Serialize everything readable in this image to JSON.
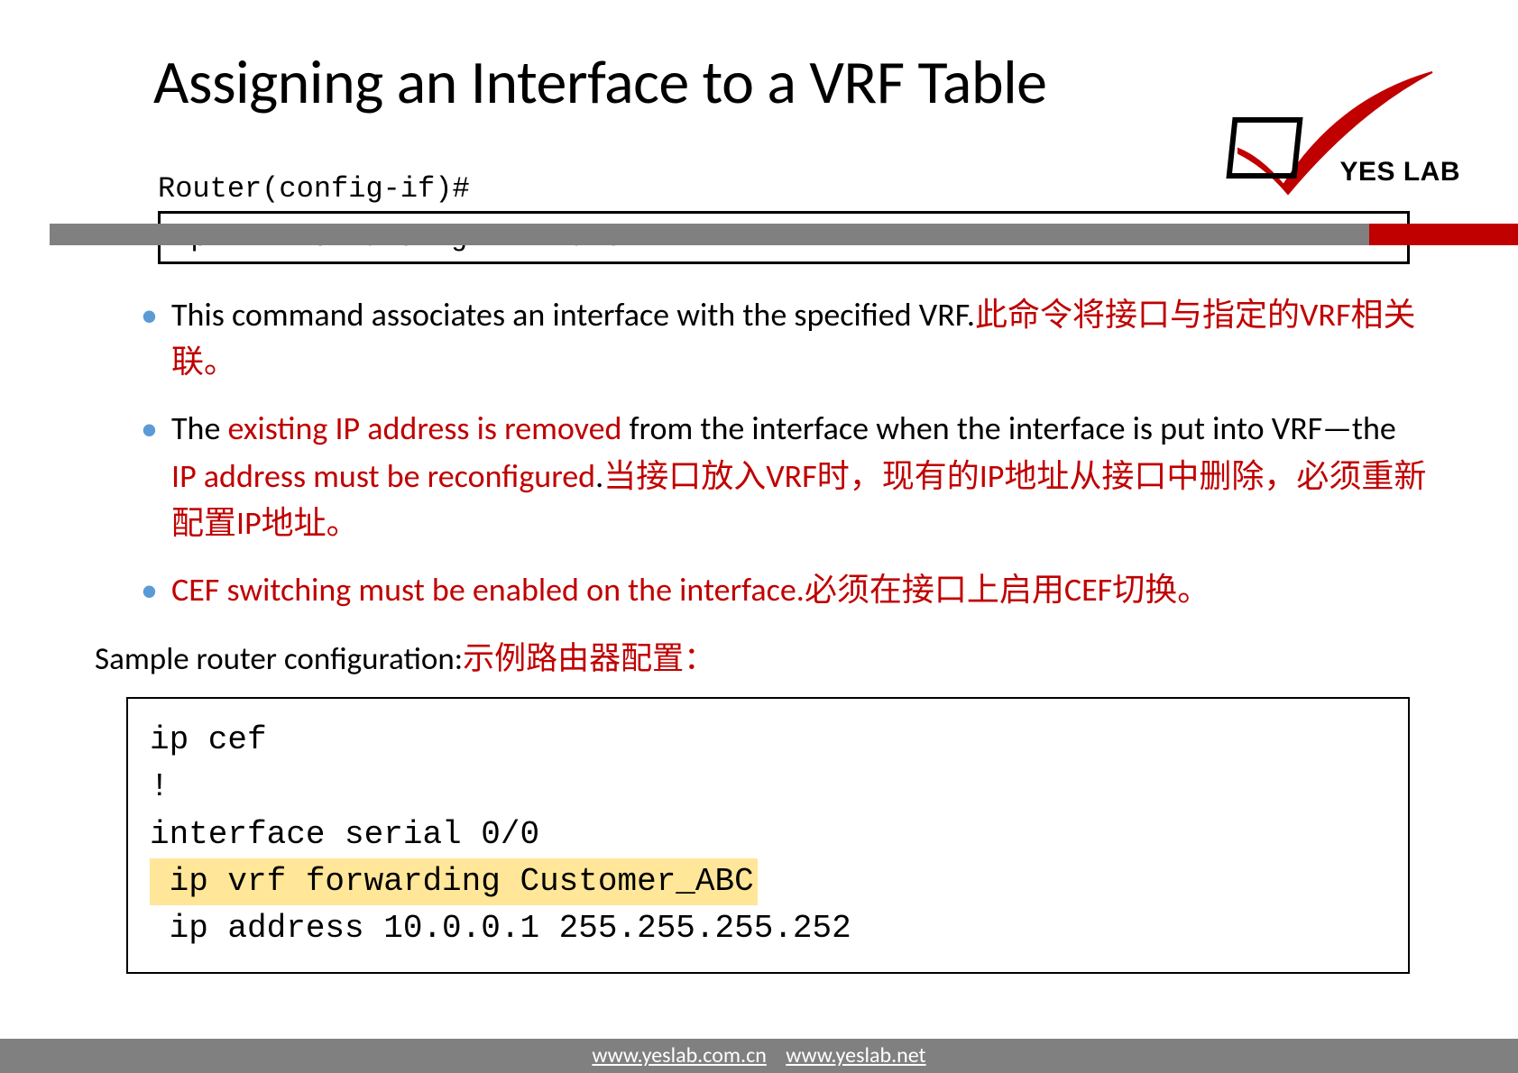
{
  "title": "Assigning an Interface to a VRF Table",
  "logo": {
    "brand": "YES LAB",
    "icon": "checkbox-checkmark"
  },
  "prompt": "Router(config-if)#",
  "command": {
    "cmd": "ip vrf forwarding ",
    "arg": "vrf-name"
  },
  "bullets": [
    {
      "main": "This command associates an interface with the specified VRF.",
      "red": "此命令将接口与指定的VRF相关联。"
    },
    {
      "pre": "The ",
      "red1": "existing IP address is removed ",
      "mid": "from the interface when the interface is put into VRF—the ",
      "red2": "IP address must be reconfigured",
      "tail": ".",
      "red3": "当接口放入VRF时，现有的IP地址从接口中删除，必须重新配置IP地址。"
    },
    {
      "red1": "CEF switching must be enabled on the interface.",
      "red2": "必须在接口上启用CEF切换。"
    }
  ],
  "sample": {
    "label": "Sample router configuration:",
    "label_red": "示例路由器配置：",
    "lines": {
      "l1": "ip cef",
      "l2": "!",
      "l3": "interface serial 0/0",
      "l4": " ip vrf forwarding Customer_ABC",
      "l5": " ip address 10.0.0.1 255.255.255.252"
    }
  },
  "footer": {
    "link1": "www.yeslab.com.cn",
    "link2": "www.yeslab.net"
  }
}
